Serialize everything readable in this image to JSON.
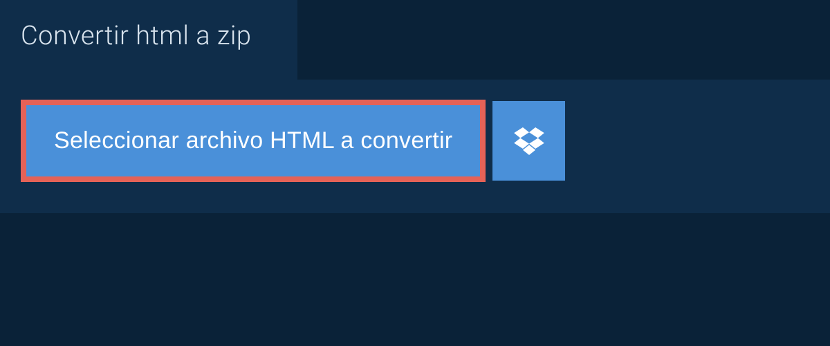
{
  "tab": {
    "title": "Convertir html a zip"
  },
  "main": {
    "select_button_label": "Seleccionar archivo HTML a convertir"
  }
}
